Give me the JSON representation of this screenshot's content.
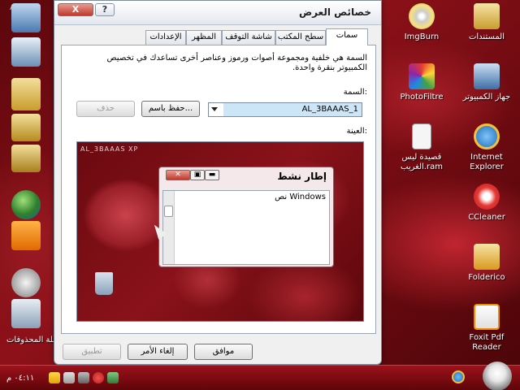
{
  "window": {
    "title": "خصائص العرض",
    "close_label": "X",
    "help_label": "?"
  },
  "tabs": [
    {
      "label": "سمات",
      "active": true
    },
    {
      "label": "سطح المكتب",
      "active": false
    },
    {
      "label": "شاشة التوقف",
      "active": false
    },
    {
      "label": "المظهر",
      "active": false
    },
    {
      "label": "الإعدادات",
      "active": false
    }
  ],
  "themes_panel": {
    "description": "السمة هي خلفية ومجموعة أصوات ورموز وعناصر أخرى تساعدك في تخصيص الكمبيوتر بنقرة واحدة.",
    "theme_label": "السمة:",
    "theme_value": "AL_3BAAAS_1",
    "save_as_label": "حفظ باسم...",
    "delete_label": "حذف",
    "sample_label": "العينة:"
  },
  "preview": {
    "theme_title": "AL_3BAAAS XP",
    "window_title": "إطار نشط",
    "window_text": "نص Windows"
  },
  "footer": {
    "ok_label": "موافق",
    "cancel_label": "إلغاء الأمر",
    "apply_label": "تطبيق"
  },
  "desktop_icons": [
    {
      "label": "المستندات",
      "icon": "folder-icon"
    },
    {
      "label": "ImgBurn",
      "icon": "disc-icon"
    },
    {
      "label": "جهاز الكمبيوتر",
      "icon": "computer-icon"
    },
    {
      "label": "PhotoFiltre",
      "icon": "photofiltre-icon"
    },
    {
      "label": "Internet Explorer",
      "icon": "ie-icon"
    },
    {
      "label": "قصيدة ليس الغريب.ram",
      "icon": "file-icon"
    },
    {
      "label": "CCleaner",
      "icon": "ccleaner-icon"
    },
    {
      "label": "Folderico",
      "icon": "folderico-icon"
    },
    {
      "label": "Foxit Pdf Reader",
      "icon": "foxit-icon"
    }
  ],
  "left_dock": {
    "badge": "Al",
    "recycle_label": "سلة المحذوفات"
  },
  "taskbar": {
    "clock": "٠٤:١١ م"
  }
}
